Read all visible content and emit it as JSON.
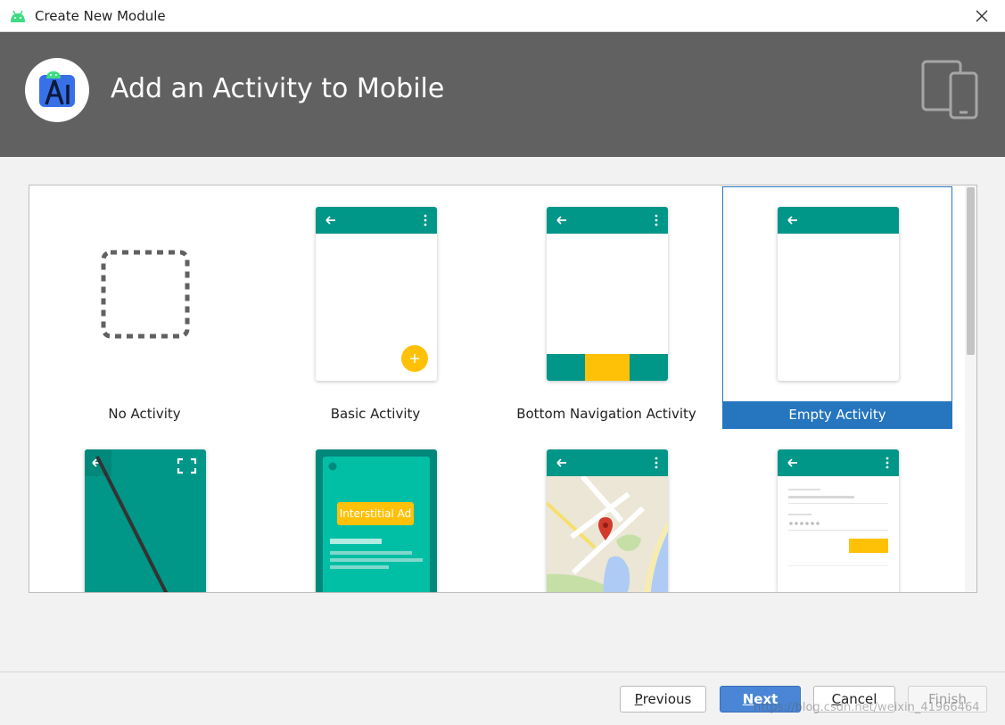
{
  "window": {
    "title": "Create New Module",
    "icon": "android-icon",
    "close_icon": "close-icon"
  },
  "header": {
    "title": "Add an Activity to Mobile",
    "logo": "android-studio-logo",
    "device_icon": "tablet-phone-icon",
    "background": "#616161"
  },
  "templates": [
    {
      "label": "No Activity",
      "icon": "no-activity-icon"
    },
    {
      "label": "Basic Activity",
      "icon": "basic-activity-preview"
    },
    {
      "label": "Bottom Navigation Activity",
      "icon": "bottom-navigation-preview"
    },
    {
      "label": "Empty Activity",
      "icon": "empty-activity-preview",
      "selected": true
    },
    {
      "label": "",
      "icon": "fullscreen-activity-preview"
    },
    {
      "label": "",
      "icon": "interstitial-ad-preview",
      "ad_text": "Interstitial Ad"
    },
    {
      "label": "",
      "icon": "google-maps-preview"
    },
    {
      "label": "",
      "icon": "login-activity-preview"
    }
  ],
  "buttons": {
    "previous": {
      "mnemonic": "P",
      "rest": "revious"
    },
    "next": {
      "mnemonic": "N",
      "rest": "ext"
    },
    "cancel": {
      "pre": "",
      "mnemonic": "C",
      "rest": "ancel"
    },
    "finish": "Finish"
  },
  "colors": {
    "accent": "#009688",
    "selection": "#2675bf",
    "fab": "#ffc107",
    "primary_button": "#4a86d5"
  },
  "watermark": "https://blog.csdn.net/weixin_41966464"
}
